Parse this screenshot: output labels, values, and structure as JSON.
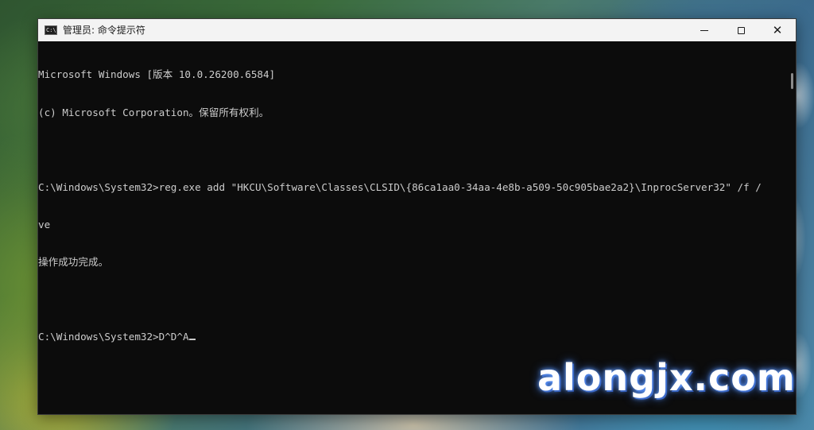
{
  "window": {
    "title": "管理员: 命令提示符",
    "icon_text": "C:\\"
  },
  "controls": {
    "minimize": "minimize-icon",
    "maximize": "maximize-icon",
    "close": "close-icon"
  },
  "console": {
    "lines": [
      "Microsoft Windows [版本 10.0.26200.6584]",
      "(c) Microsoft Corporation。保留所有权利。",
      "",
      "C:\\Windows\\System32>reg.exe add \"HKCU\\Software\\Classes\\CLSID\\{86ca1aa0-34aa-4e8b-a509-50c905bae2a2}\\InprocServer32\" /f /",
      "ve",
      "操作成功完成。",
      "",
      "C:\\Windows\\System32>D^D^A"
    ]
  },
  "watermark": {
    "text": "alongjx.com"
  }
}
